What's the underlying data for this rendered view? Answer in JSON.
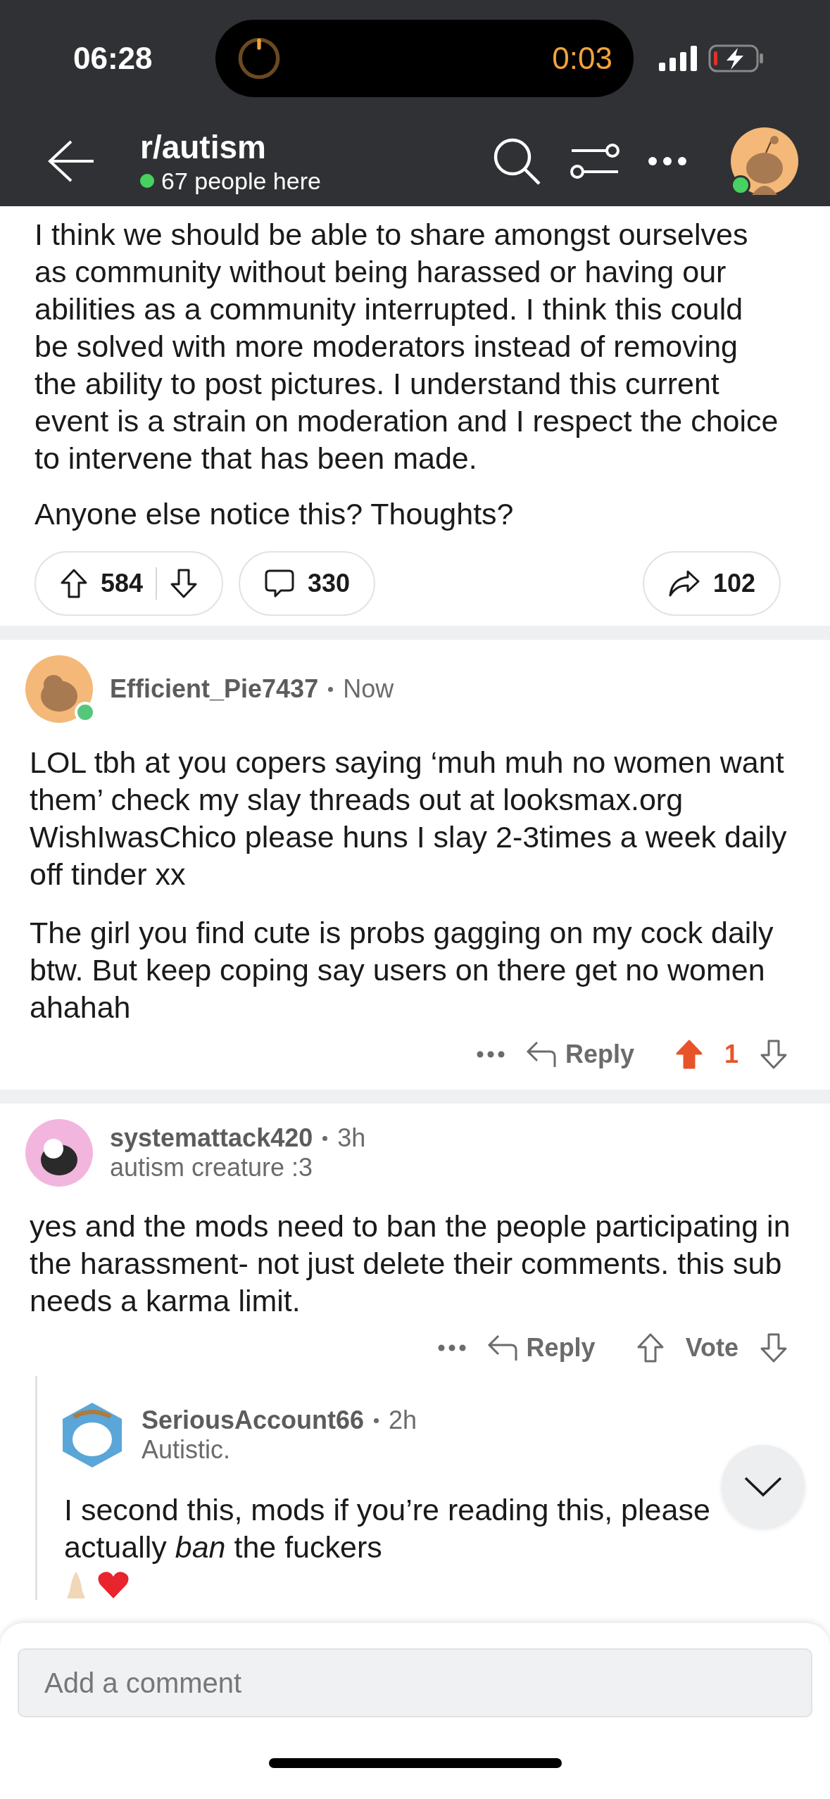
{
  "status_bar": {
    "time": "06:28",
    "timer": "0:03"
  },
  "header": {
    "title": "r/autism",
    "online_count": "67 people here",
    "online": true
  },
  "post": {
    "paragraphs": [
      "I think we should be able to share amongst ourselves as community without being harassed or having our abilities as a community interrupted. I think this could be solved with more moderators instead of removing the ability to post pictures. I understand this current event is a strain on moderation and I respect the choice to intervene that has been made.",
      "Anyone else notice this? Thoughts?"
    ],
    "votes": "584",
    "comments": "330",
    "shares": "102"
  },
  "comments": [
    {
      "author": "Efficient_Pie7437",
      "time": "Now",
      "online": true,
      "paragraphs": [
        "LOL tbh at you copers saying ‘muh muh no women want them’ check my slay threads out at looksmax.org WishIwasChico please huns I slay 2-3times a week daily off tinder xx",
        "The girl you find cute is probs gagging on my cock daily btw. But keep coping say users on there get no women ahahah"
      ],
      "reply_label": "Reply",
      "vote_label": "1",
      "upvoted": true
    },
    {
      "author": "systemattack420",
      "time": "3h",
      "flair": "autism creature :3",
      "paragraphs": [
        "yes and the mods need to ban the people participating in the harassment- not just delete their comments. this sub needs a karma limit."
      ],
      "reply_label": "Reply",
      "vote_label": "Vote",
      "upvoted": false,
      "children": [
        {
          "author": "SeriousAccount66",
          "time": "2h",
          "flair": "Autistic.",
          "paragraphs": [
            "I second this, mods if you’re reading this, please actually *ban* the fuckers"
          ]
        }
      ]
    }
  ],
  "comment_box": {
    "placeholder": "Add a comment"
  }
}
